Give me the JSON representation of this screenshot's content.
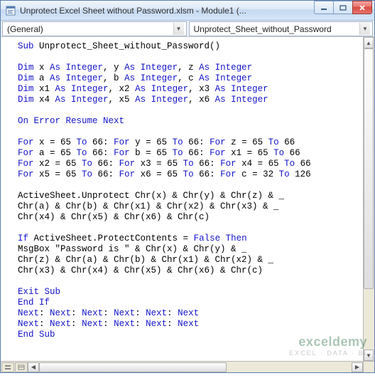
{
  "window": {
    "title": "Unprotect Excel Sheet without Password.xlsm - Module1 (..."
  },
  "toolbar": {
    "object_dropdown": "(General)",
    "procedure_dropdown": "Unprotect_Sheet_without_Password"
  },
  "code": {
    "tokens": [
      [
        {
          "t": "Sub ",
          "kw": true
        },
        {
          "t": "Unprotect_Sheet_without_Password()"
        }
      ],
      [],
      [
        {
          "t": "Dim ",
          "kw": true
        },
        {
          "t": "x "
        },
        {
          "t": "As Integer",
          "kw": true
        },
        {
          "t": ", y "
        },
        {
          "t": "As Integer",
          "kw": true
        },
        {
          "t": ", z "
        },
        {
          "t": "As Integer",
          "kw": true
        }
      ],
      [
        {
          "t": "Dim ",
          "kw": true
        },
        {
          "t": "a "
        },
        {
          "t": "As Integer",
          "kw": true
        },
        {
          "t": ", b "
        },
        {
          "t": "As Integer",
          "kw": true
        },
        {
          "t": ", c "
        },
        {
          "t": "As Integer",
          "kw": true
        }
      ],
      [
        {
          "t": "Dim ",
          "kw": true
        },
        {
          "t": "x1 "
        },
        {
          "t": "As Integer",
          "kw": true
        },
        {
          "t": ", x2 "
        },
        {
          "t": "As Integer",
          "kw": true
        },
        {
          "t": ", x3 "
        },
        {
          "t": "As Integer",
          "kw": true
        }
      ],
      [
        {
          "t": "Dim ",
          "kw": true
        },
        {
          "t": "x4 "
        },
        {
          "t": "As Integer",
          "kw": true
        },
        {
          "t": ", x5 "
        },
        {
          "t": "As Integer",
          "kw": true
        },
        {
          "t": ", x6 "
        },
        {
          "t": "As Integer",
          "kw": true
        }
      ],
      [],
      [
        {
          "t": "On Error Resume Next",
          "kw": true
        }
      ],
      [],
      [
        {
          "t": "For ",
          "kw": true
        },
        {
          "t": "x = 65 "
        },
        {
          "t": "To ",
          "kw": true
        },
        {
          "t": "66: "
        },
        {
          "t": "For ",
          "kw": true
        },
        {
          "t": "y = 65 "
        },
        {
          "t": "To ",
          "kw": true
        },
        {
          "t": "66: "
        },
        {
          "t": "For ",
          "kw": true
        },
        {
          "t": "z = 65 "
        },
        {
          "t": "To ",
          "kw": true
        },
        {
          "t": "66"
        }
      ],
      [
        {
          "t": "For ",
          "kw": true
        },
        {
          "t": "a = 65 "
        },
        {
          "t": "To ",
          "kw": true
        },
        {
          "t": "66: "
        },
        {
          "t": "For ",
          "kw": true
        },
        {
          "t": "b = 65 "
        },
        {
          "t": "To ",
          "kw": true
        },
        {
          "t": "66: "
        },
        {
          "t": "For ",
          "kw": true
        },
        {
          "t": "x1 = 65 "
        },
        {
          "t": "To ",
          "kw": true
        },
        {
          "t": "66"
        }
      ],
      [
        {
          "t": "For ",
          "kw": true
        },
        {
          "t": "x2 = 65 "
        },
        {
          "t": "To ",
          "kw": true
        },
        {
          "t": "66: "
        },
        {
          "t": "For ",
          "kw": true
        },
        {
          "t": "x3 = 65 "
        },
        {
          "t": "To ",
          "kw": true
        },
        {
          "t": "66: "
        },
        {
          "t": "For ",
          "kw": true
        },
        {
          "t": "x4 = 65 "
        },
        {
          "t": "To ",
          "kw": true
        },
        {
          "t": "66"
        }
      ],
      [
        {
          "t": "For ",
          "kw": true
        },
        {
          "t": "x5 = 65 "
        },
        {
          "t": "To ",
          "kw": true
        },
        {
          "t": "66: "
        },
        {
          "t": "For ",
          "kw": true
        },
        {
          "t": "x6 = 65 "
        },
        {
          "t": "To ",
          "kw": true
        },
        {
          "t": "66: "
        },
        {
          "t": "For ",
          "kw": true
        },
        {
          "t": "c = 32 "
        },
        {
          "t": "To ",
          "kw": true
        },
        {
          "t": "126"
        }
      ],
      [],
      [
        {
          "t": "ActiveSheet.Unprotect Chr(x) & Chr(y) & Chr(z) & _"
        }
      ],
      [
        {
          "t": "Chr(a) & Chr(b) & Chr(x1) & Chr(x2) & Chr(x3) & _"
        }
      ],
      [
        {
          "t": "Chr(x4) & Chr(x5) & Chr(x6) & Chr(c)"
        }
      ],
      [],
      [
        {
          "t": "If ",
          "kw": true
        },
        {
          "t": "ActiveSheet.ProtectContents = "
        },
        {
          "t": "False Then",
          "kw": true
        }
      ],
      [
        {
          "t": "MsgBox \"Password is \" & Chr(x) & Chr(y) & _"
        }
      ],
      [
        {
          "t": "Chr(z) & Chr(a) & Chr(b) & Chr(x1) & Chr(x2) & _"
        }
      ],
      [
        {
          "t": "Chr(x3) & Chr(x4) & Chr(x5) & Chr(x6) & Chr(c)"
        }
      ],
      [],
      [
        {
          "t": "Exit Sub",
          "kw": true
        }
      ],
      [
        {
          "t": "End If",
          "kw": true
        }
      ],
      [
        {
          "t": "Next",
          "kw": true
        },
        {
          "t": ": "
        },
        {
          "t": "Next",
          "kw": true
        },
        {
          "t": ": "
        },
        {
          "t": "Next",
          "kw": true
        },
        {
          "t": ": "
        },
        {
          "t": "Next",
          "kw": true
        },
        {
          "t": ": "
        },
        {
          "t": "Next",
          "kw": true
        },
        {
          "t": ": "
        },
        {
          "t": "Next",
          "kw": true
        }
      ],
      [
        {
          "t": "Next",
          "kw": true
        },
        {
          "t": ": "
        },
        {
          "t": "Next",
          "kw": true
        },
        {
          "t": ": "
        },
        {
          "t": "Next",
          "kw": true
        },
        {
          "t": ": "
        },
        {
          "t": "Next",
          "kw": true
        },
        {
          "t": ": "
        },
        {
          "t": "Next",
          "kw": true
        },
        {
          "t": ": "
        },
        {
          "t": "Next",
          "kw": true
        }
      ],
      [
        {
          "t": "End Sub",
          "kw": true
        }
      ]
    ]
  },
  "watermark": {
    "line1": "exceldemy",
    "line2": "EXCEL · DATA · BI"
  }
}
